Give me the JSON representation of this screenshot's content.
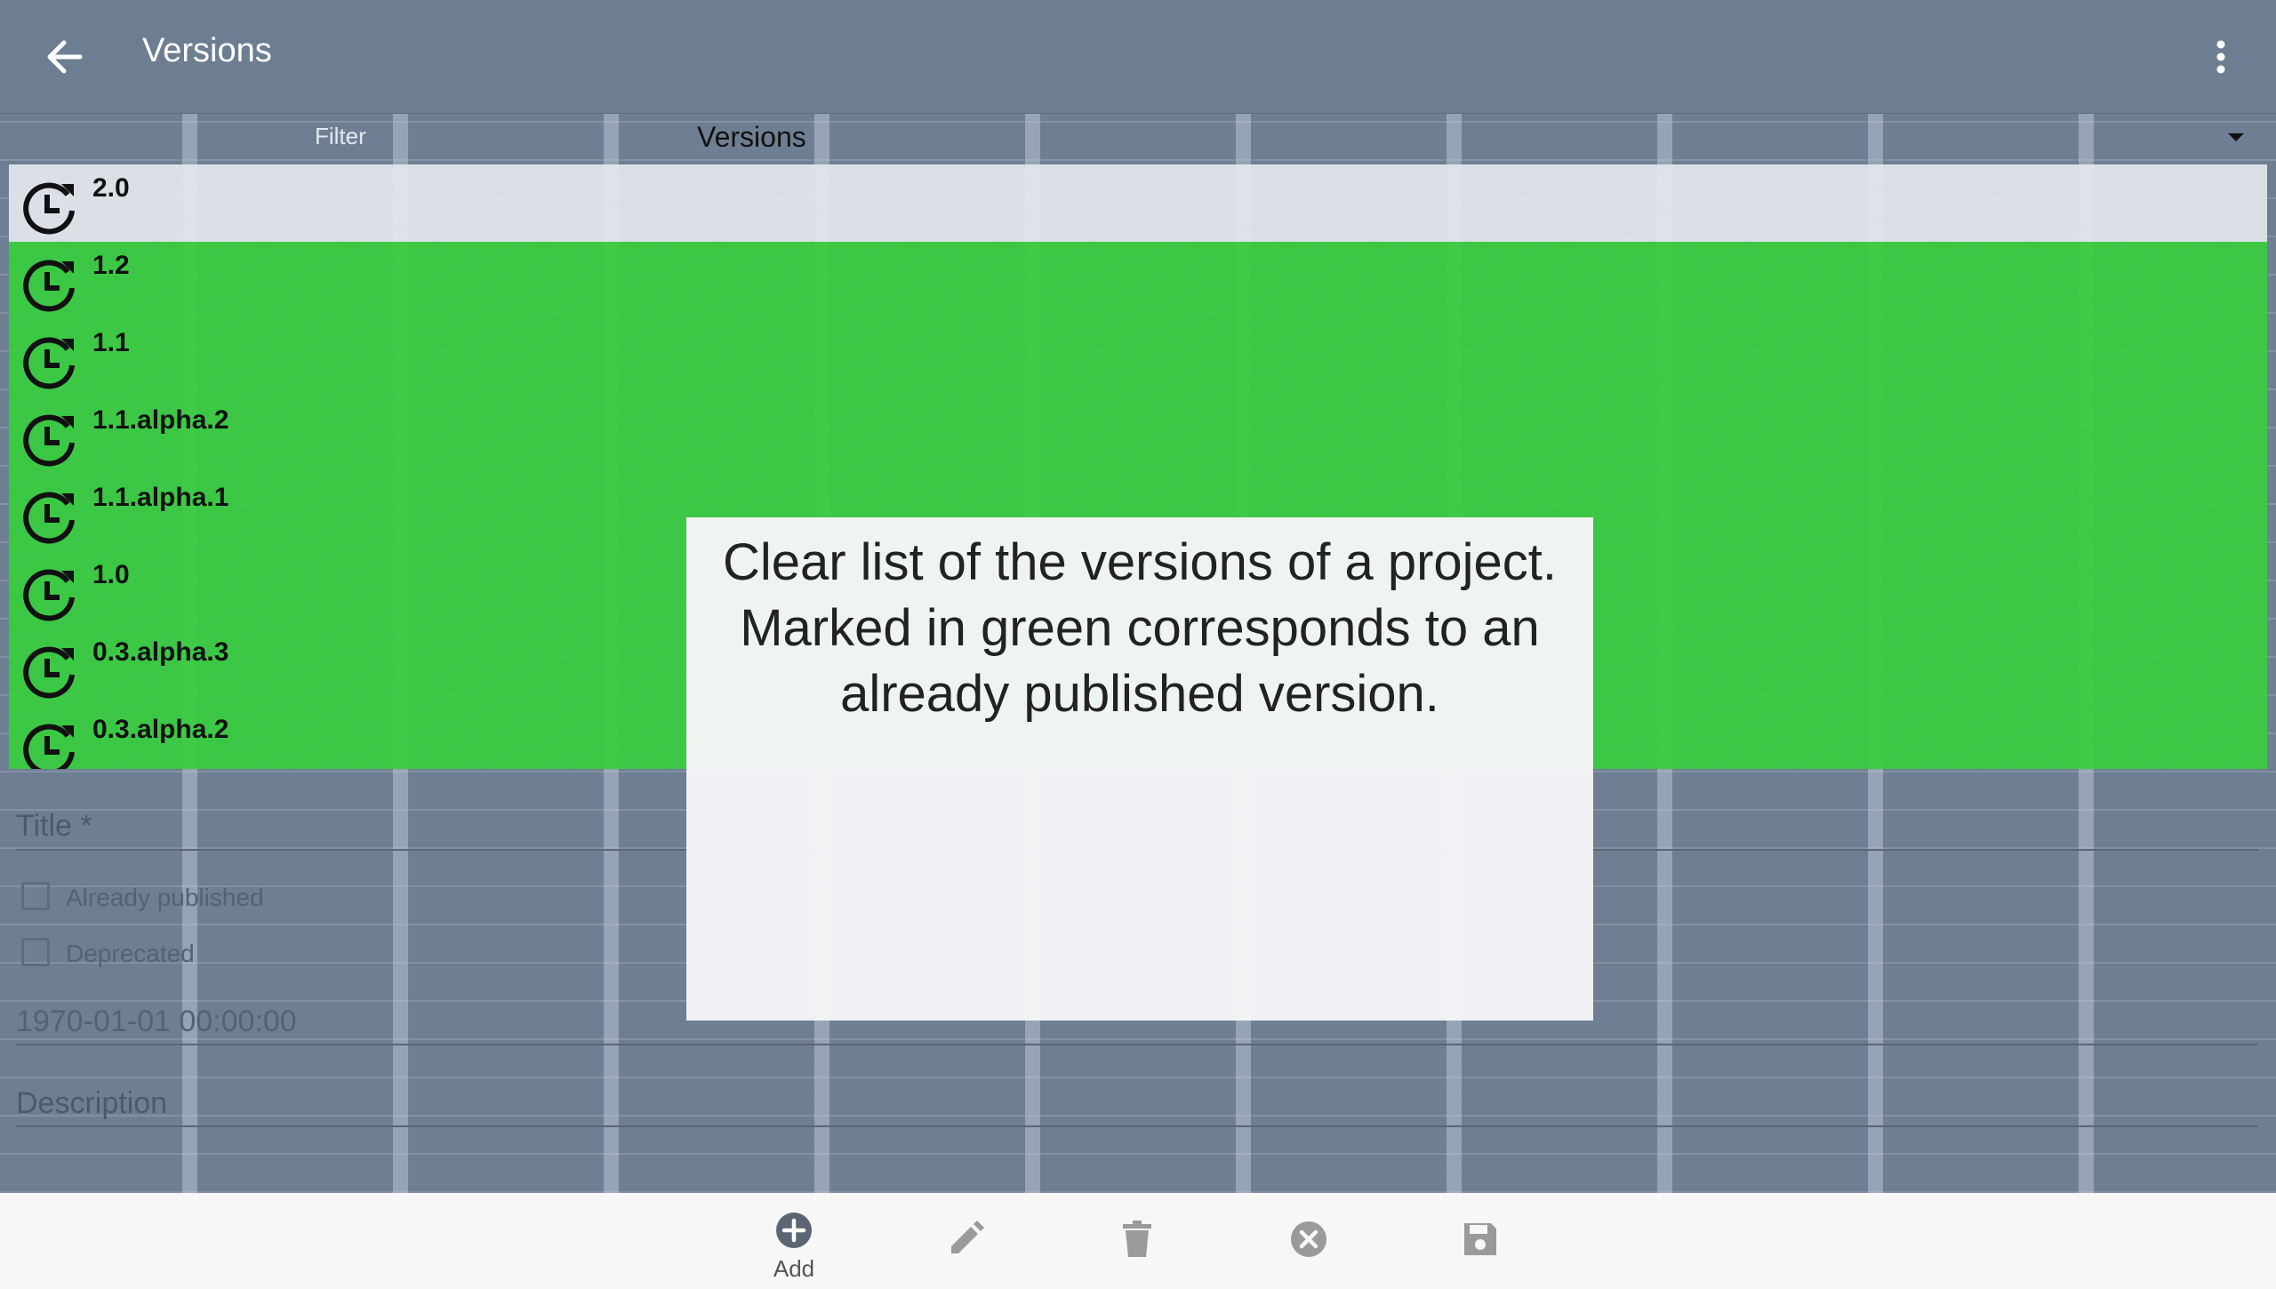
{
  "appbar": {
    "title": "Versions",
    "back_icon": "arrow-back-icon",
    "menu_icon": "more-vert-icon"
  },
  "filter": {
    "label": "Filter",
    "value": "Versions"
  },
  "versions": [
    {
      "name": "2.0",
      "published": false,
      "selected": true
    },
    {
      "name": "1.2",
      "published": true
    },
    {
      "name": "1.1",
      "published": true
    },
    {
      "name": "1.1.alpha.2",
      "published": true
    },
    {
      "name": "1.1.alpha.1",
      "published": true
    },
    {
      "name": "1.0",
      "published": true
    },
    {
      "name": "0.3.alpha.3",
      "published": true
    },
    {
      "name": "0.3.alpha.2",
      "published": true
    }
  ],
  "form": {
    "title_label": "Title *",
    "already_published_label": "Already published",
    "deprecated_label": "Deprecated",
    "date_value": "1970-01-01 00:00:00",
    "description_label": "Description"
  },
  "toolbar": {
    "add_label": "Add"
  },
  "overlay": {
    "line1": "Clear list of the versions of a project.",
    "line2": "Marked in green corresponds to an already published version."
  },
  "colors": {
    "published": "#38ce40",
    "appbar": "#6e7e92",
    "selected_row": "#e4e8ee"
  }
}
